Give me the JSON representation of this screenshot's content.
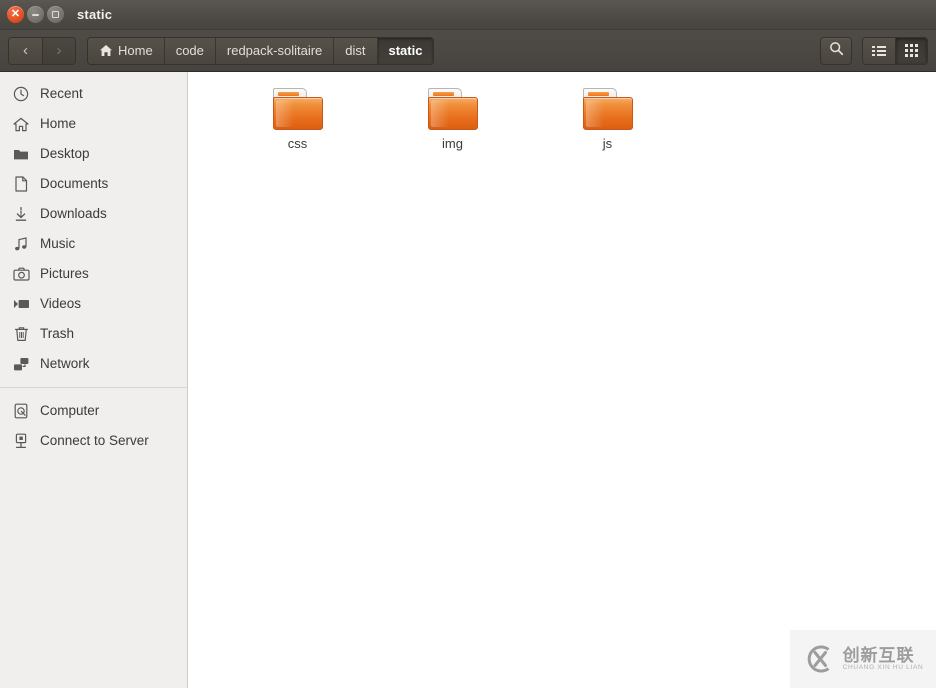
{
  "window": {
    "title": "static",
    "controls": [
      {
        "name": "close",
        "label": "×"
      },
      {
        "name": "minimize",
        "label": "–"
      },
      {
        "name": "maximize",
        "label": "□"
      }
    ]
  },
  "toolbar": {
    "back_label": "‹",
    "forward_label": "›",
    "search_label": "search-icon",
    "view_list_label": "list-view-icon",
    "view_grid_label": "grid-view-icon",
    "breadcrumbs": [
      {
        "label": "Home",
        "icon": "home-icon",
        "active": false
      },
      {
        "label": "code",
        "icon": "",
        "active": false
      },
      {
        "label": "redpack-solitaire",
        "icon": "",
        "active": false
      },
      {
        "label": "dist",
        "icon": "",
        "active": false
      },
      {
        "label": "static",
        "icon": "",
        "active": true
      }
    ]
  },
  "sidebar": {
    "items": [
      {
        "label": "Recent",
        "icon": "clock-icon"
      },
      {
        "label": "Home",
        "icon": "home-icon"
      },
      {
        "label": "Desktop",
        "icon": "folder-icon"
      },
      {
        "label": "Documents",
        "icon": "document-icon"
      },
      {
        "label": "Downloads",
        "icon": "download-icon"
      },
      {
        "label": "Music",
        "icon": "music-note-icon"
      },
      {
        "label": "Pictures",
        "icon": "camera-icon"
      },
      {
        "label": "Videos",
        "icon": "video-icon"
      },
      {
        "label": "Trash",
        "icon": "trash-icon"
      },
      {
        "label": "Network",
        "icon": "network-icon"
      }
    ],
    "items_bottom": [
      {
        "label": "Computer",
        "icon": "computer-icon"
      },
      {
        "label": "Connect to Server",
        "icon": "server-icon"
      }
    ]
  },
  "content": {
    "files": [
      {
        "name": "css",
        "type": "folder"
      },
      {
        "name": "img",
        "type": "folder"
      },
      {
        "name": "js",
        "type": "folder"
      }
    ]
  },
  "watermark": {
    "chinese": "创新互联",
    "pinyin": "CHUANG XIN HU LIAN",
    "logo": "cx-circle-logo"
  },
  "colors": {
    "titlebar": "#4e4a45",
    "toolbar": "#47433e",
    "sidebar": "#f0efed",
    "content": "#ffffff",
    "folder_orange": "#e8701d",
    "close_button": "#e24f21"
  }
}
